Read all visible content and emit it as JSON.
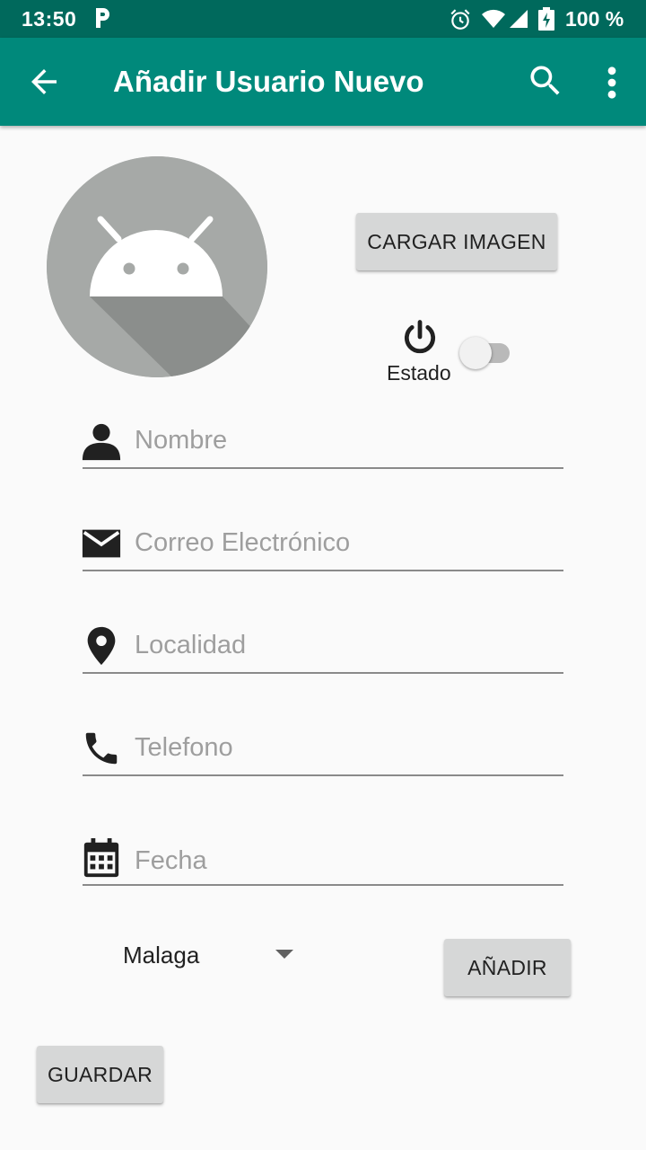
{
  "status_bar": {
    "time": "13:50",
    "battery_text": "100 %",
    "icons": [
      "parking-icon",
      "alarm-icon",
      "wifi-icon",
      "signal-icon",
      "battery-icon"
    ]
  },
  "app_bar": {
    "title": "Añadir Usuario Nuevo",
    "back_icon": "arrow-back-icon",
    "search_icon": "search-icon",
    "more_icon": "more-vert-icon",
    "color": "#00897b",
    "status_color": "#00695c"
  },
  "profile": {
    "load_image_label": "CARGAR IMAGEN",
    "estado_label": "Estado",
    "estado_on": false
  },
  "form": {
    "nombre_placeholder": "Nombre",
    "correo_placeholder": "Correo Electrónico",
    "localidad_placeholder": "Localidad",
    "telefono_placeholder": "Telefono",
    "fecha_placeholder": "Fecha"
  },
  "location_spinner": {
    "selected": "Malaga"
  },
  "buttons": {
    "anadir_label": "AÑADIR",
    "guardar_label": "GUARDAR"
  }
}
